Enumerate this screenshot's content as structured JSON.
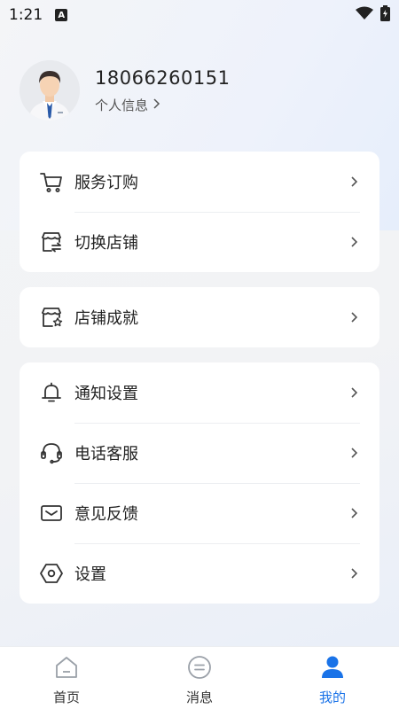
{
  "status_bar": {
    "time": "1:21",
    "notification_icon": "A"
  },
  "profile": {
    "phone": "18066260151",
    "info_link": "个人信息"
  },
  "menu": {
    "group1": [
      {
        "label": "服务订购",
        "icon": "cart-icon"
      },
      {
        "label": "切换店铺",
        "icon": "store-switch-icon"
      }
    ],
    "group2": [
      {
        "label": "店铺成就",
        "icon": "store-achievement-icon"
      }
    ],
    "group3": [
      {
        "label": "通知设置",
        "icon": "bell-icon"
      },
      {
        "label": "电话客服",
        "icon": "headset-icon"
      },
      {
        "label": "意见反馈",
        "icon": "mail-icon"
      },
      {
        "label": "设置",
        "icon": "settings-hex-icon"
      }
    ]
  },
  "tabbar": {
    "tabs": [
      {
        "label": "首页",
        "icon": "home-icon",
        "active": false
      },
      {
        "label": "消息",
        "icon": "message-icon",
        "active": false
      },
      {
        "label": "我的",
        "icon": "user-icon",
        "active": true
      }
    ]
  },
  "colors": {
    "accent": "#1a73e8",
    "card_bg": "#ffffff",
    "page_bg": "#f2f3f5"
  }
}
